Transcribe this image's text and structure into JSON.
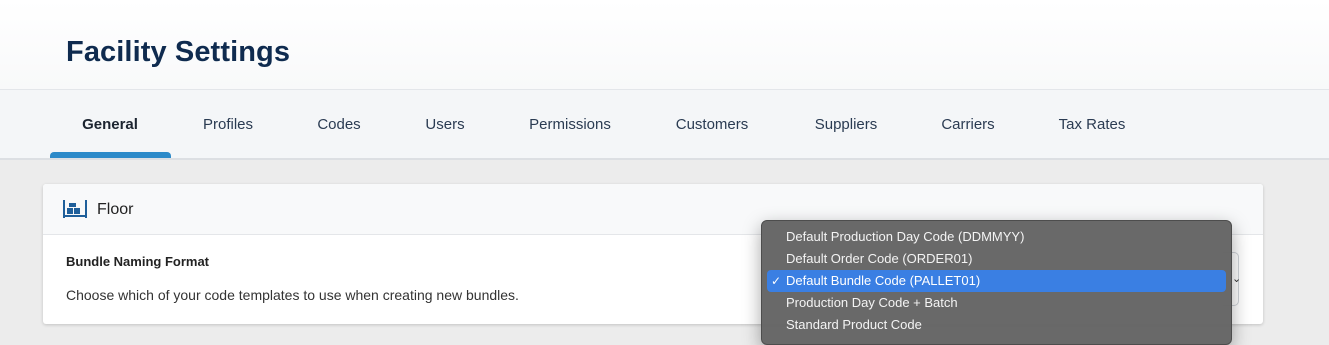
{
  "page": {
    "title": "Facility Settings"
  },
  "tabs": [
    {
      "label": "General",
      "active": true
    },
    {
      "label": "Profiles"
    },
    {
      "label": "Codes"
    },
    {
      "label": "Users"
    },
    {
      "label": "Permissions"
    },
    {
      "label": "Customers"
    },
    {
      "label": "Suppliers"
    },
    {
      "label": "Carriers"
    },
    {
      "label": "Tax Rates"
    }
  ],
  "colors": {
    "title": "#0f2b4f",
    "active_tab_indicator": "#2c8ac9",
    "dropdown_bg": "#646464",
    "selected_option": "#3a7fe3",
    "floor_icon": "#1f5f9a"
  },
  "card": {
    "icon": "floor-icon",
    "title": "Floor",
    "setting": {
      "label": "Bundle Naming Format",
      "description": "Choose which of your code templates to use when creating new bundles.",
      "selected": "Default Bundle Code (PALLET01)",
      "options": [
        "Default Production Day Code (DDMMYY)",
        "Default Order Code (ORDER01)",
        "Default Bundle Code (PALLET01)",
        "Production Day Code + Batch",
        "Standard Product Code"
      ],
      "check_glyph": "✓",
      "chevron_glyph": "⌄"
    }
  }
}
